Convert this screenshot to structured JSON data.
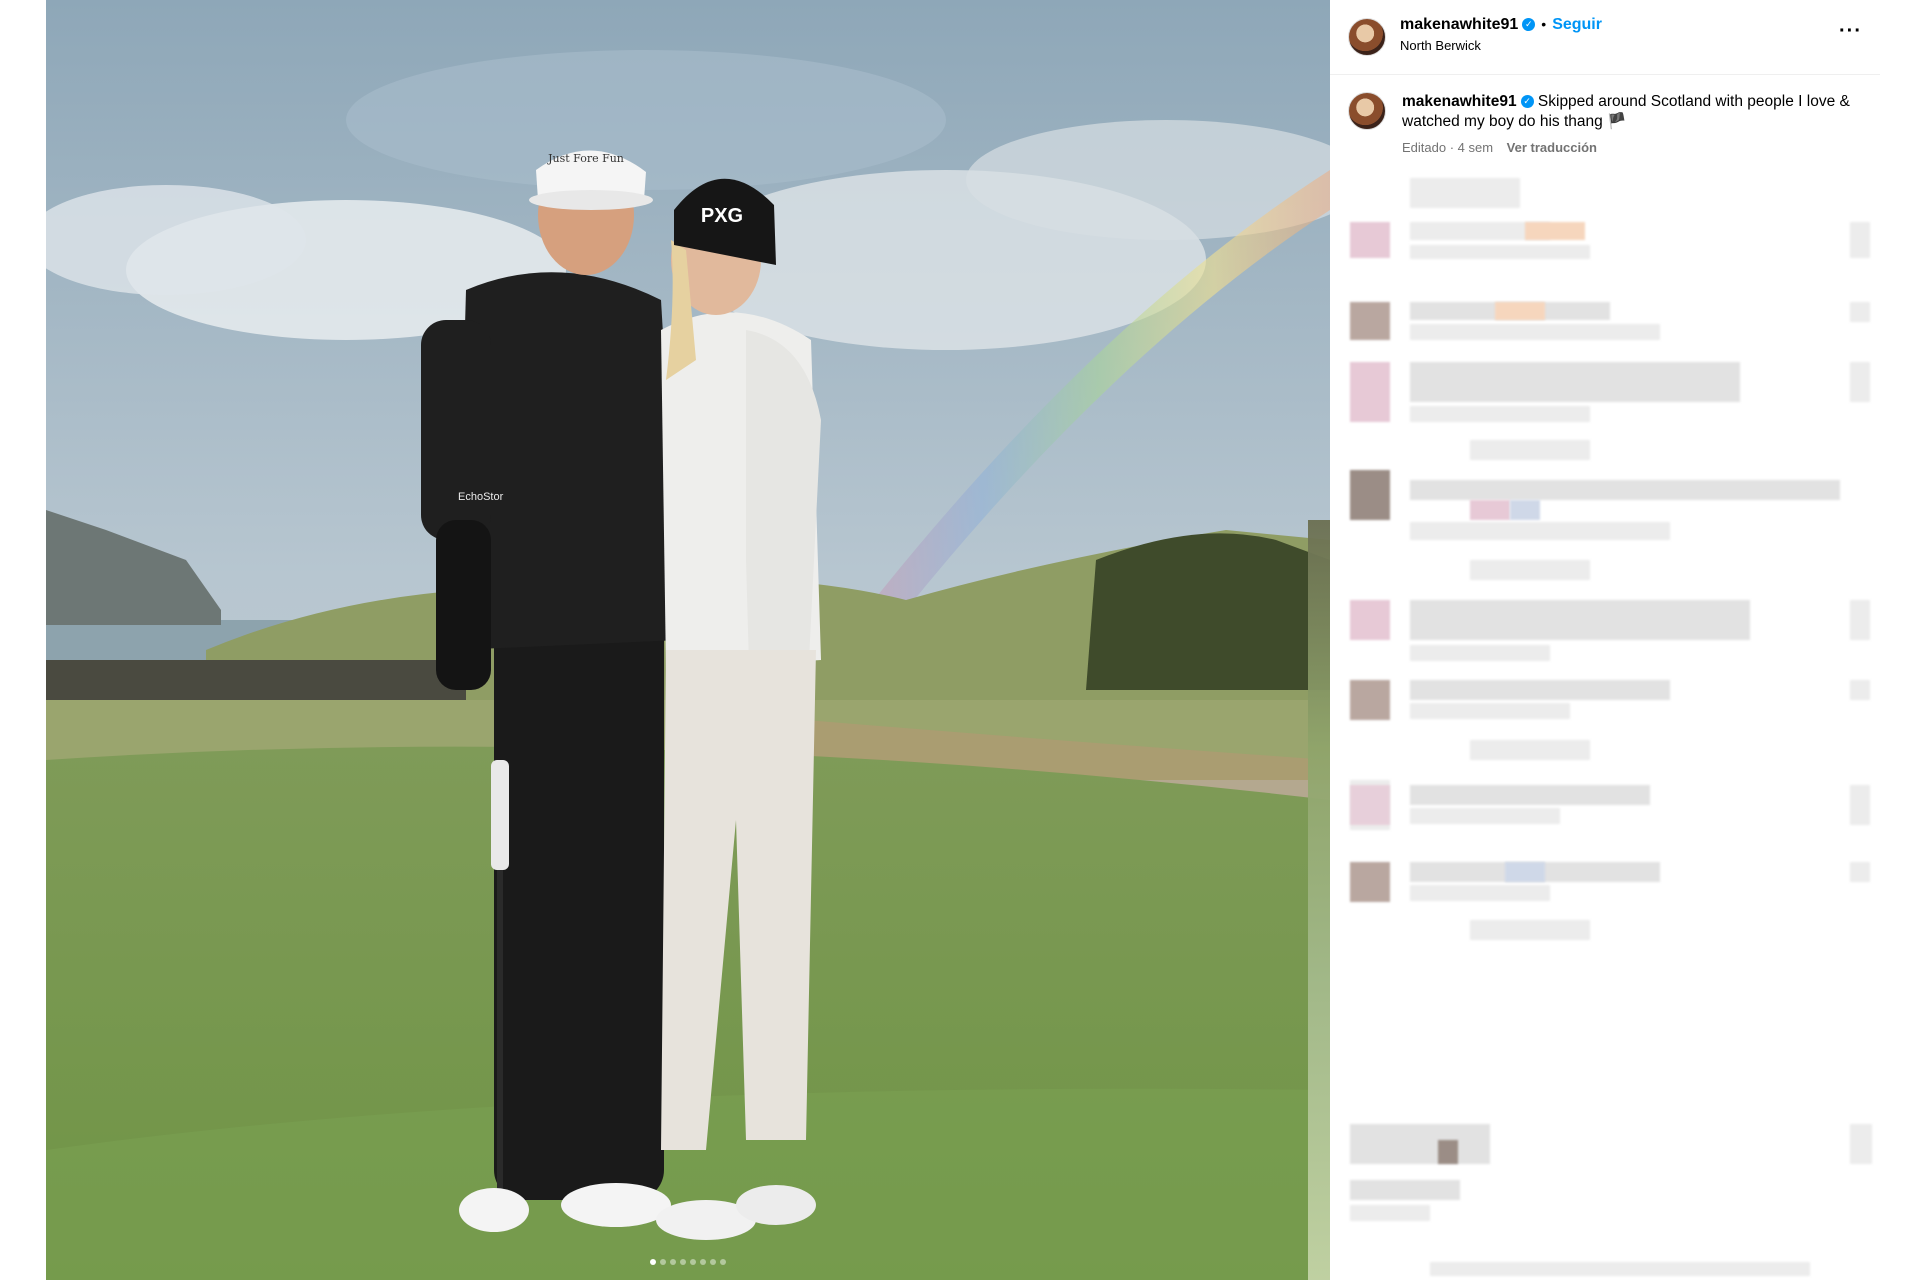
{
  "post": {
    "username": "makenawhite91",
    "verified_mark": "✓",
    "separator": "•",
    "follow_label": "Seguir",
    "location": "North Berwick",
    "more_label": "···"
  },
  "caption": {
    "username": "makenawhite91",
    "text": "Skipped around Scotland with people I love & watched my boy do his thang 🏴",
    "edited": "Editado · 4 sem",
    "translate_label": "Ver traducción"
  },
  "photo": {
    "cap_text": "Just Fore Fun",
    "beanie_text": "PXG",
    "sponsor_text": "EchoStor"
  },
  "carousel": {
    "count": 8,
    "active_index": 0
  },
  "icons": {
    "verified": "verified-badge-icon",
    "more": "more-options-icon",
    "flag": "scotland-flag-icon"
  },
  "colors": {
    "accent": "#0095f6",
    "secondary_text": "#737373",
    "divider": "#efefef"
  }
}
